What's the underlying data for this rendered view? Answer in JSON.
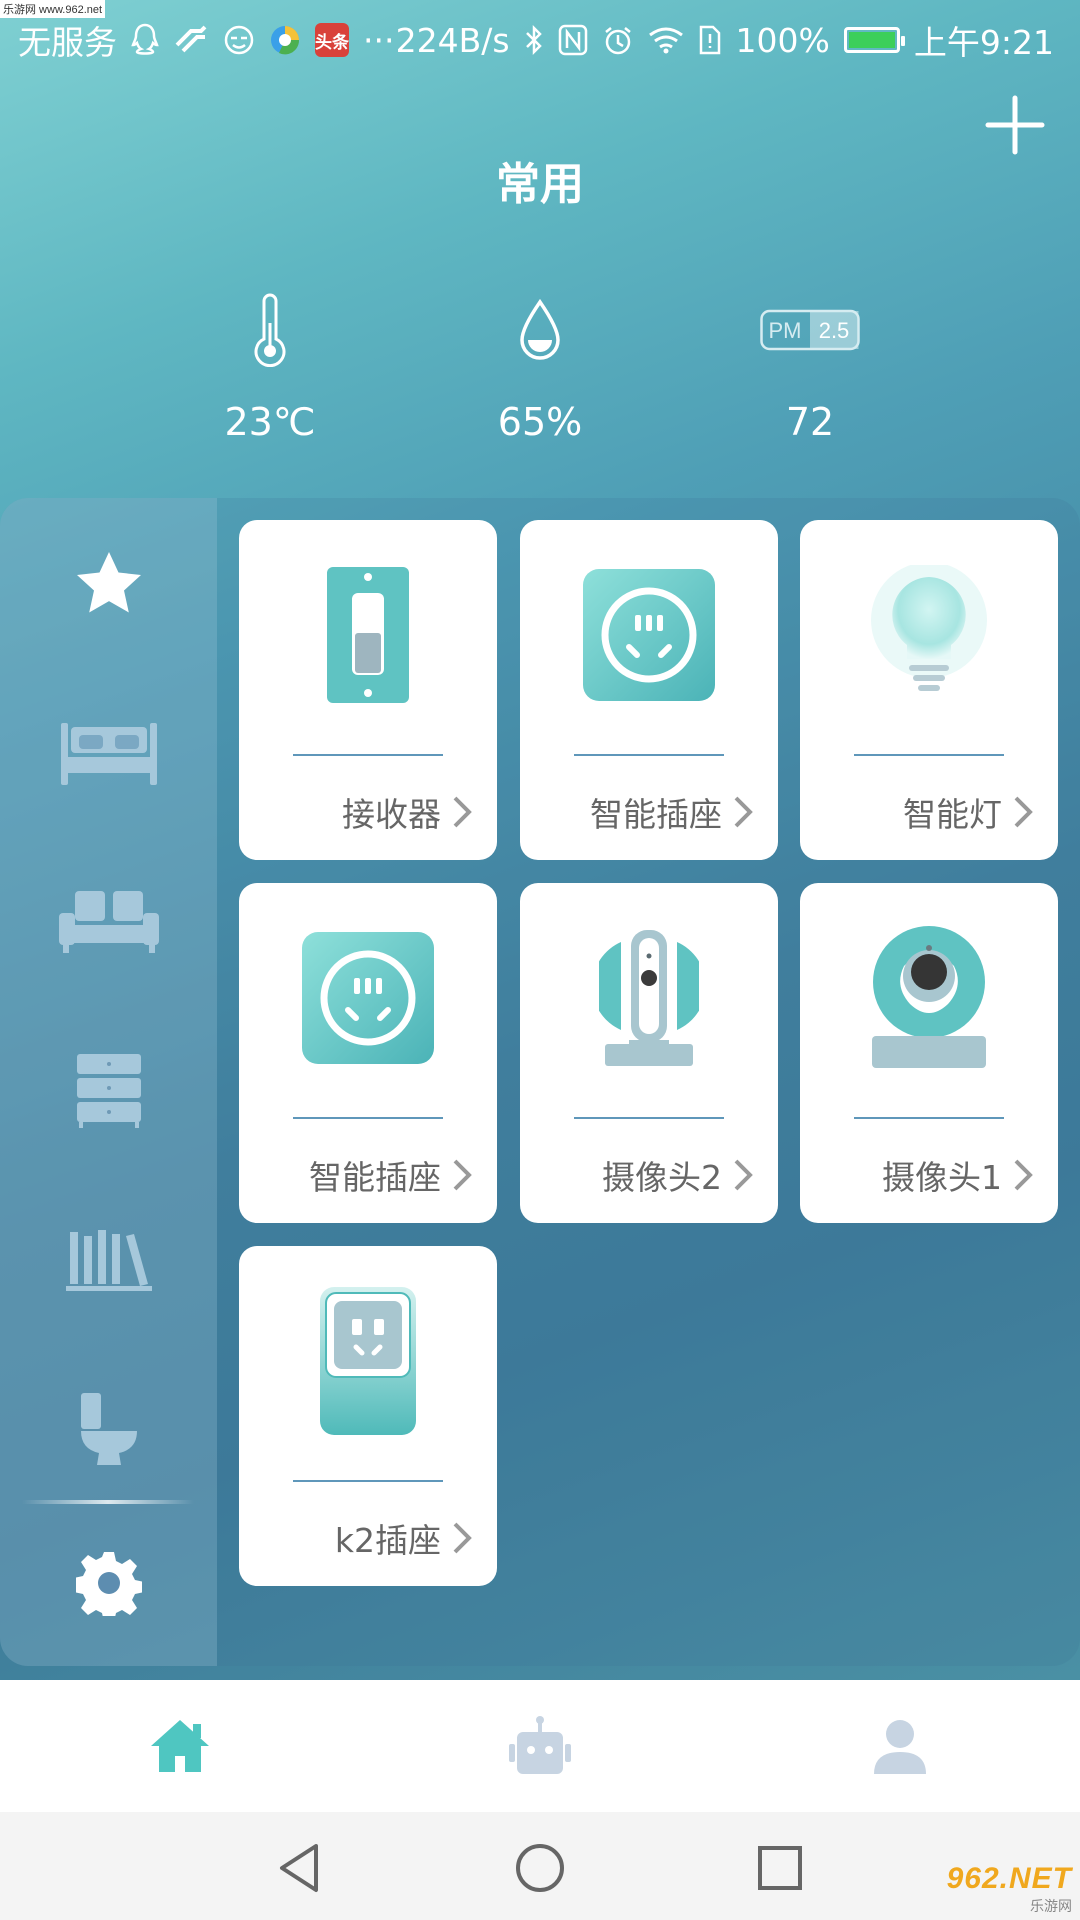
{
  "watermark_top": "乐游网 www.962.net",
  "status_bar": {
    "carrier": "无服务",
    "netspeed": "224B/s",
    "battery": "100%",
    "time": "上午9:21",
    "more": "···",
    "news_badge": "头条",
    "nfc": "N"
  },
  "header": {
    "title": "常用"
  },
  "env": {
    "temperature": "23℃",
    "humidity": "65%",
    "pm25": "72",
    "pm_label_left": "PM",
    "pm_label_right": "2.5"
  },
  "sidebar": {
    "items": [
      "favorites-icon",
      "bedroom-icon",
      "living-room-icon",
      "cabinet-icon",
      "study-icon",
      "bathroom-icon",
      "settings-icon"
    ]
  },
  "devices": [
    {
      "label": "接收器",
      "icon": "receiver-icon"
    },
    {
      "label": "智能插座",
      "icon": "smart-socket-icon"
    },
    {
      "label": "智能灯",
      "icon": "smart-bulb-icon"
    },
    {
      "label": "智能插座",
      "icon": "smart-socket-icon"
    },
    {
      "label": "摄像头2",
      "icon": "camera-icon"
    },
    {
      "label": "摄像头1",
      "icon": "dome-camera-icon"
    },
    {
      "label": "k2插座",
      "icon": "k2-socket-icon"
    }
  ],
  "bottom_nav": {
    "items": [
      "home-icon",
      "robot-icon",
      "profile-icon"
    ],
    "active": "home-icon"
  },
  "watermark_bottom": {
    "brand": "962.NET",
    "sub": "乐游网"
  },
  "colors": {
    "accent": "#4fc6c1",
    "teal_device": "#5ec2c0",
    "nav_inactive": "#c7d4e2"
  }
}
